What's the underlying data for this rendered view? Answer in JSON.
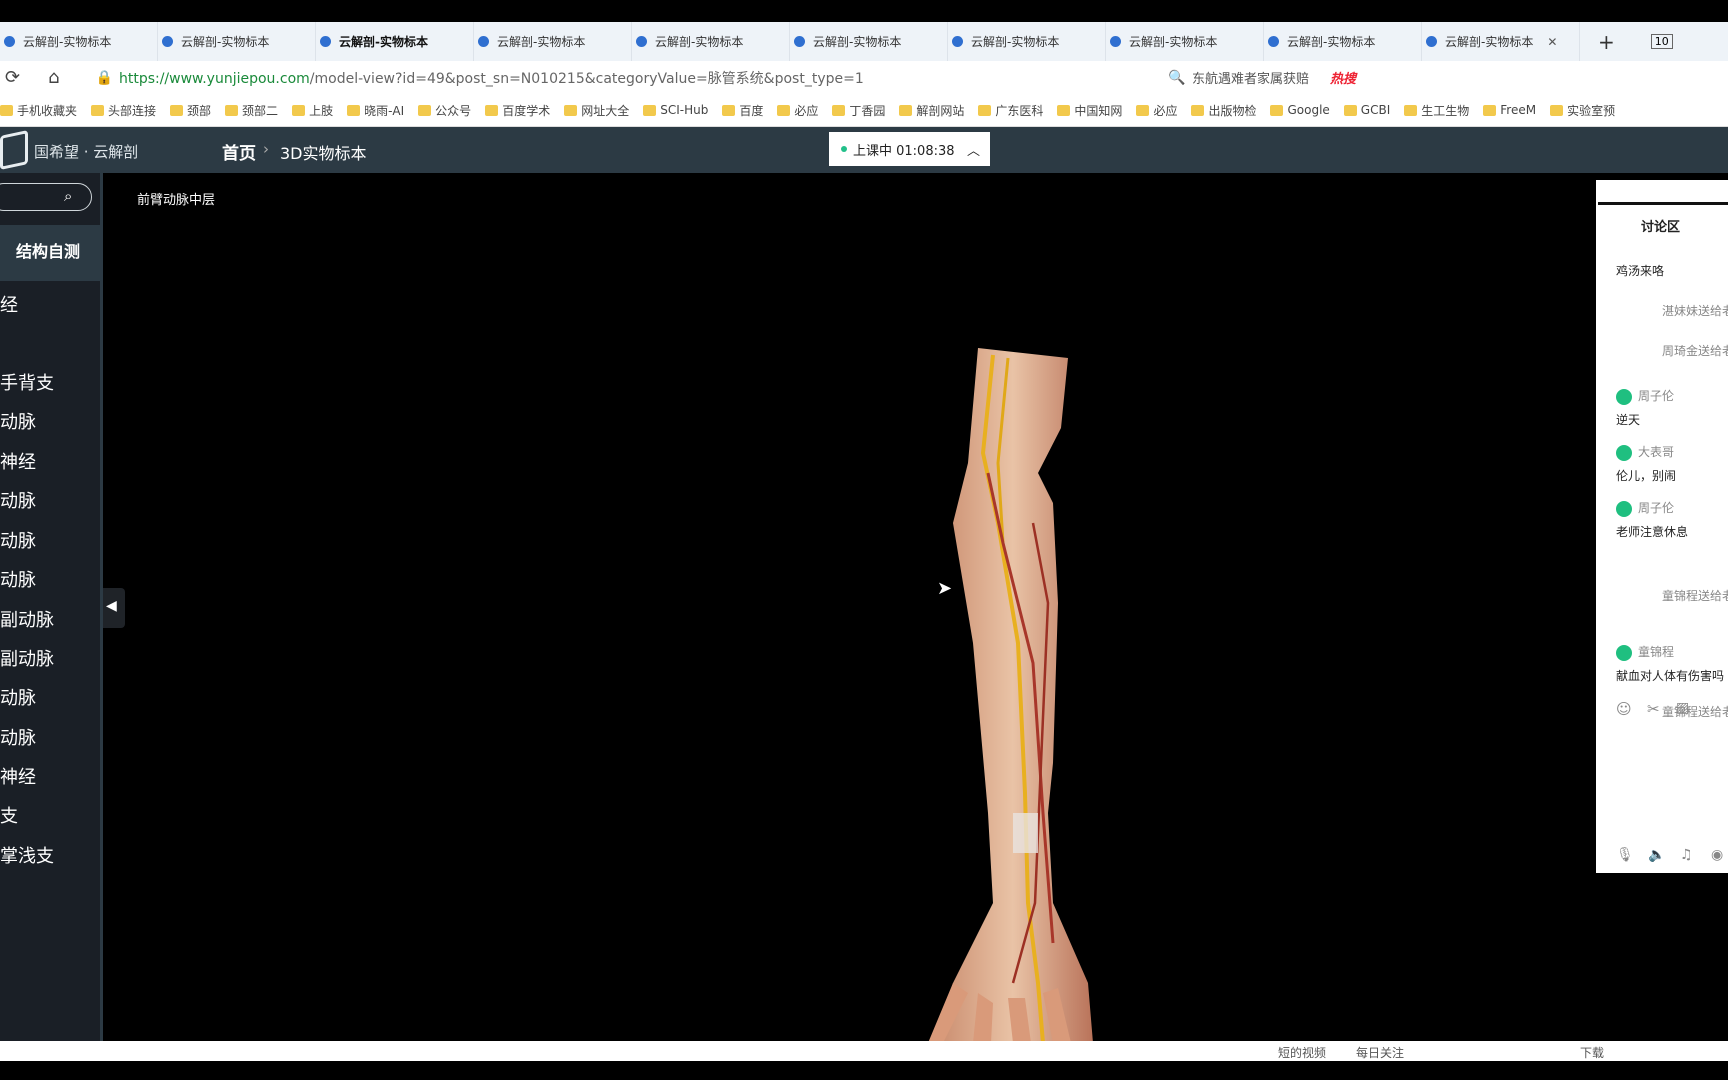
{
  "browser": {
    "tabs": [
      {
        "label": "云解剖-实物标本"
      },
      {
        "label": "云解剖-实物标本"
      },
      {
        "label": "云解剖-实物标本",
        "active": true
      },
      {
        "label": "云解剖-实物标本"
      },
      {
        "label": "云解剖-实物标本"
      },
      {
        "label": "云解剖-实物标本"
      },
      {
        "label": "云解剖-实物标本"
      },
      {
        "label": "云解剖-实物标本"
      },
      {
        "label": "云解剖-实物标本"
      },
      {
        "label": "云解剖-实物标本"
      }
    ],
    "tab_count": "10",
    "url_host": "https://www.yunjiepou.com",
    "url_path": "/model-view?id=49&post_sn=N010215&categoryValue=脉管系统&post_type=1",
    "search_hint": "东航遇难者家属获赔",
    "hot_label": "热搜",
    "bookmarks": [
      "手机收藏夹",
      "头部连接",
      "颈部",
      "颈部二",
      "上肢",
      "晓雨-AI",
      "公众号",
      "百度学术",
      "网址大全",
      "SCI-Hub",
      "百度",
      "必应",
      "丁香园",
      "解剖网站",
      "广东医科",
      "中国知网",
      "必应",
      "出版物检",
      "Google",
      "GCBI",
      "生工生物",
      "FreeM",
      "实验室预"
    ]
  },
  "app": {
    "logo": "国希望 · 云解剖",
    "breadcrumb": [
      "首页",
      "3D实物标本"
    ],
    "live_status": "上课中 01:08:38",
    "live_color": "#22c08a"
  },
  "sidebar": {
    "self_test": "结构自测",
    "items": [
      "经",
      "手背支",
      "动脉",
      "神经",
      "动脉",
      "动脉",
      "动脉",
      "副动脉",
      "副动脉",
      "动脉",
      "动脉",
      "神经",
      "支",
      "掌浅支"
    ]
  },
  "viewer": {
    "model_title": "前臂动脉中层"
  },
  "chat": {
    "title": "讨论区",
    "messages": [
      {
        "type": "text",
        "text": "鸡汤来咯"
      },
      {
        "type": "gift",
        "text": "湛妹妹送给老"
      },
      {
        "type": "gift",
        "text": "周琦金送给老"
      },
      {
        "type": "user",
        "user": "周子伦",
        "text": "逆天"
      },
      {
        "type": "user",
        "user": "大表哥",
        "text": "伦儿，别闹"
      },
      {
        "type": "user",
        "user": "周子伦",
        "text": "老师注意休息"
      },
      {
        "type": "gift",
        "text": "童锦程送给老"
      },
      {
        "type": "user",
        "user": "童锦程",
        "text": "献血对人体有伤害吗"
      },
      {
        "type": "gift",
        "text": "童锦程送给老"
      }
    ]
  },
  "taskbar": [
    "短的视频",
    "每日关注",
    "下载"
  ]
}
